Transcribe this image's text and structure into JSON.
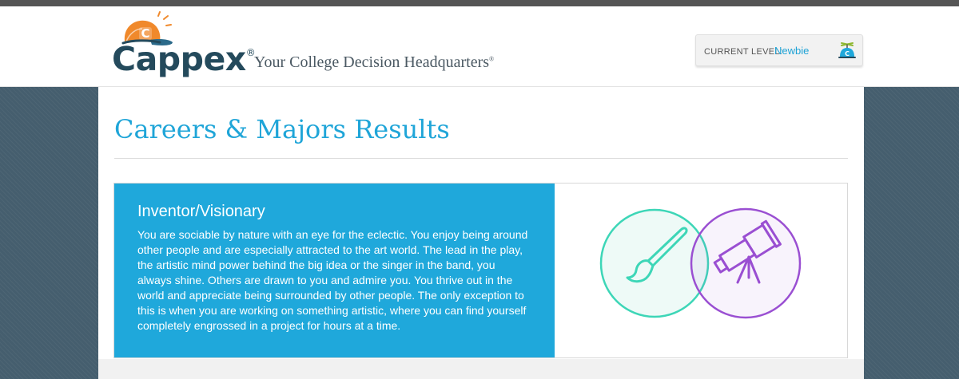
{
  "header": {
    "logo_text": "Cappex",
    "logo_badge": "C",
    "tagline": "Your College Decision Headquarters",
    "level_label": "CURRENT LEVEL:",
    "level_value": "Newbie",
    "level_icon_letter": "C"
  },
  "main": {
    "title": "Careers & Majors Results"
  },
  "result": {
    "title": "Inventor/Visionary",
    "description": "You are sociable by nature with an eye for the eclectic. You enjoy being around other people and are especially attracted to the art world. The lead in the play, the artistic mind power behind the big idea or the singer in the band, you always shine. Others are drawn to you and admire you. You thrive out in the world and appreciate being surrounded by other people. The only exception to this is when you are working on something artistic, where you can find yourself completely engrossed in a project for hours at a time.",
    "icons": [
      "paintbrush-icon",
      "telescope-icon"
    ]
  },
  "colors": {
    "brand_blue": "#1fa8db",
    "brand_orange": "#f0892b",
    "logo_navy": "#244a5c",
    "teal_circle": "#3dd6b7",
    "purple_circle": "#9a4fd2",
    "background": "#455e6e"
  }
}
